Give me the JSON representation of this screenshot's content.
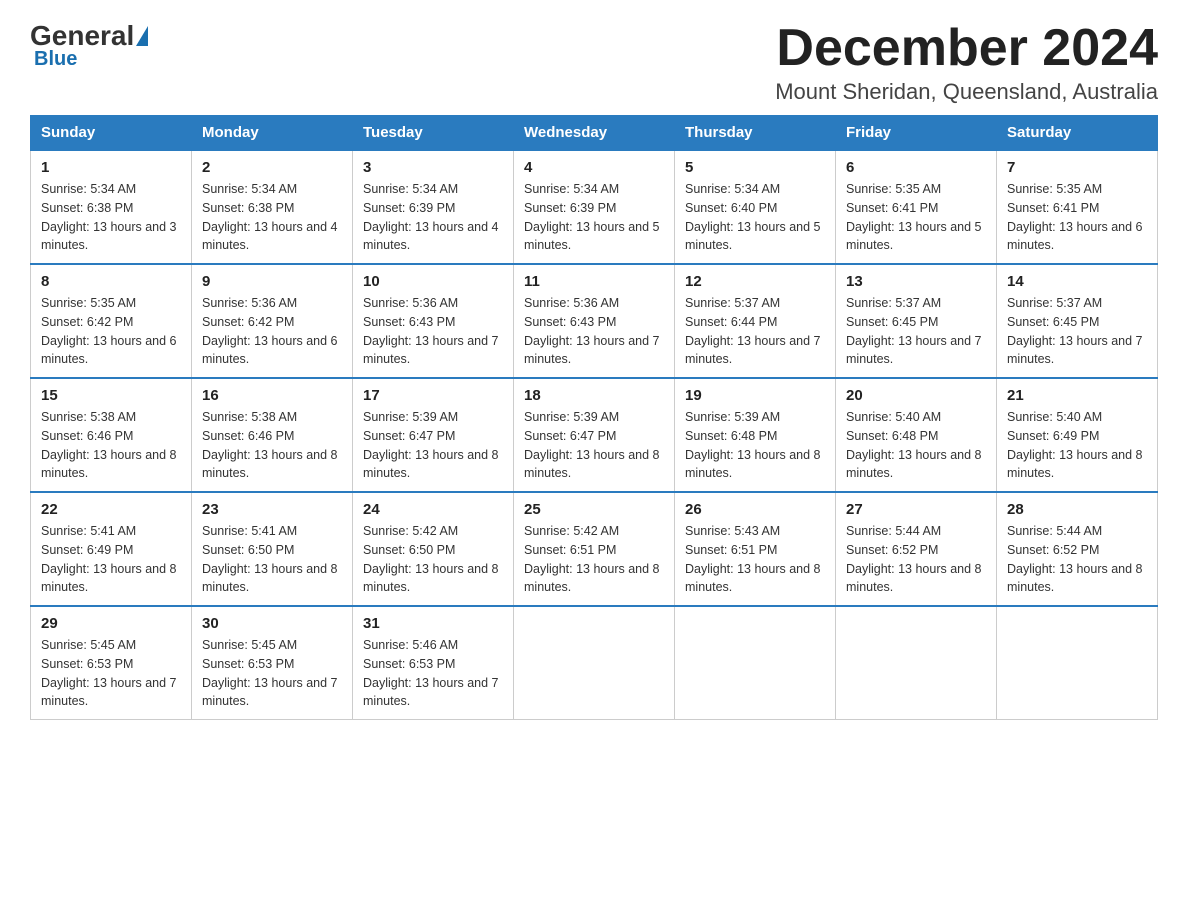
{
  "header": {
    "logo_general": "General",
    "logo_blue": "Blue",
    "month_title": "December 2024",
    "location": "Mount Sheridan, Queensland, Australia"
  },
  "weekdays": [
    "Sunday",
    "Monday",
    "Tuesday",
    "Wednesday",
    "Thursday",
    "Friday",
    "Saturday"
  ],
  "weeks": [
    [
      {
        "day": "1",
        "sunrise": "5:34 AM",
        "sunset": "6:38 PM",
        "daylight": "13 hours and 3 minutes."
      },
      {
        "day": "2",
        "sunrise": "5:34 AM",
        "sunset": "6:38 PM",
        "daylight": "13 hours and 4 minutes."
      },
      {
        "day": "3",
        "sunrise": "5:34 AM",
        "sunset": "6:39 PM",
        "daylight": "13 hours and 4 minutes."
      },
      {
        "day": "4",
        "sunrise": "5:34 AM",
        "sunset": "6:39 PM",
        "daylight": "13 hours and 5 minutes."
      },
      {
        "day": "5",
        "sunrise": "5:34 AM",
        "sunset": "6:40 PM",
        "daylight": "13 hours and 5 minutes."
      },
      {
        "day": "6",
        "sunrise": "5:35 AM",
        "sunset": "6:41 PM",
        "daylight": "13 hours and 5 minutes."
      },
      {
        "day": "7",
        "sunrise": "5:35 AM",
        "sunset": "6:41 PM",
        "daylight": "13 hours and 6 minutes."
      }
    ],
    [
      {
        "day": "8",
        "sunrise": "5:35 AM",
        "sunset": "6:42 PM",
        "daylight": "13 hours and 6 minutes."
      },
      {
        "day": "9",
        "sunrise": "5:36 AM",
        "sunset": "6:42 PM",
        "daylight": "13 hours and 6 minutes."
      },
      {
        "day": "10",
        "sunrise": "5:36 AM",
        "sunset": "6:43 PM",
        "daylight": "13 hours and 7 minutes."
      },
      {
        "day": "11",
        "sunrise": "5:36 AM",
        "sunset": "6:43 PM",
        "daylight": "13 hours and 7 minutes."
      },
      {
        "day": "12",
        "sunrise": "5:37 AM",
        "sunset": "6:44 PM",
        "daylight": "13 hours and 7 minutes."
      },
      {
        "day": "13",
        "sunrise": "5:37 AM",
        "sunset": "6:45 PM",
        "daylight": "13 hours and 7 minutes."
      },
      {
        "day": "14",
        "sunrise": "5:37 AM",
        "sunset": "6:45 PM",
        "daylight": "13 hours and 7 minutes."
      }
    ],
    [
      {
        "day": "15",
        "sunrise": "5:38 AM",
        "sunset": "6:46 PM",
        "daylight": "13 hours and 8 minutes."
      },
      {
        "day": "16",
        "sunrise": "5:38 AM",
        "sunset": "6:46 PM",
        "daylight": "13 hours and 8 minutes."
      },
      {
        "day": "17",
        "sunrise": "5:39 AM",
        "sunset": "6:47 PM",
        "daylight": "13 hours and 8 minutes."
      },
      {
        "day": "18",
        "sunrise": "5:39 AM",
        "sunset": "6:47 PM",
        "daylight": "13 hours and 8 minutes."
      },
      {
        "day": "19",
        "sunrise": "5:39 AM",
        "sunset": "6:48 PM",
        "daylight": "13 hours and 8 minutes."
      },
      {
        "day": "20",
        "sunrise": "5:40 AM",
        "sunset": "6:48 PM",
        "daylight": "13 hours and 8 minutes."
      },
      {
        "day": "21",
        "sunrise": "5:40 AM",
        "sunset": "6:49 PM",
        "daylight": "13 hours and 8 minutes."
      }
    ],
    [
      {
        "day": "22",
        "sunrise": "5:41 AM",
        "sunset": "6:49 PM",
        "daylight": "13 hours and 8 minutes."
      },
      {
        "day": "23",
        "sunrise": "5:41 AM",
        "sunset": "6:50 PM",
        "daylight": "13 hours and 8 minutes."
      },
      {
        "day": "24",
        "sunrise": "5:42 AM",
        "sunset": "6:50 PM",
        "daylight": "13 hours and 8 minutes."
      },
      {
        "day": "25",
        "sunrise": "5:42 AM",
        "sunset": "6:51 PM",
        "daylight": "13 hours and 8 minutes."
      },
      {
        "day": "26",
        "sunrise": "5:43 AM",
        "sunset": "6:51 PM",
        "daylight": "13 hours and 8 minutes."
      },
      {
        "day": "27",
        "sunrise": "5:44 AM",
        "sunset": "6:52 PM",
        "daylight": "13 hours and 8 minutes."
      },
      {
        "day": "28",
        "sunrise": "5:44 AM",
        "sunset": "6:52 PM",
        "daylight": "13 hours and 8 minutes."
      }
    ],
    [
      {
        "day": "29",
        "sunrise": "5:45 AM",
        "sunset": "6:53 PM",
        "daylight": "13 hours and 7 minutes."
      },
      {
        "day": "30",
        "sunrise": "5:45 AM",
        "sunset": "6:53 PM",
        "daylight": "13 hours and 7 minutes."
      },
      {
        "day": "31",
        "sunrise": "5:46 AM",
        "sunset": "6:53 PM",
        "daylight": "13 hours and 7 minutes."
      },
      null,
      null,
      null,
      null
    ]
  ]
}
